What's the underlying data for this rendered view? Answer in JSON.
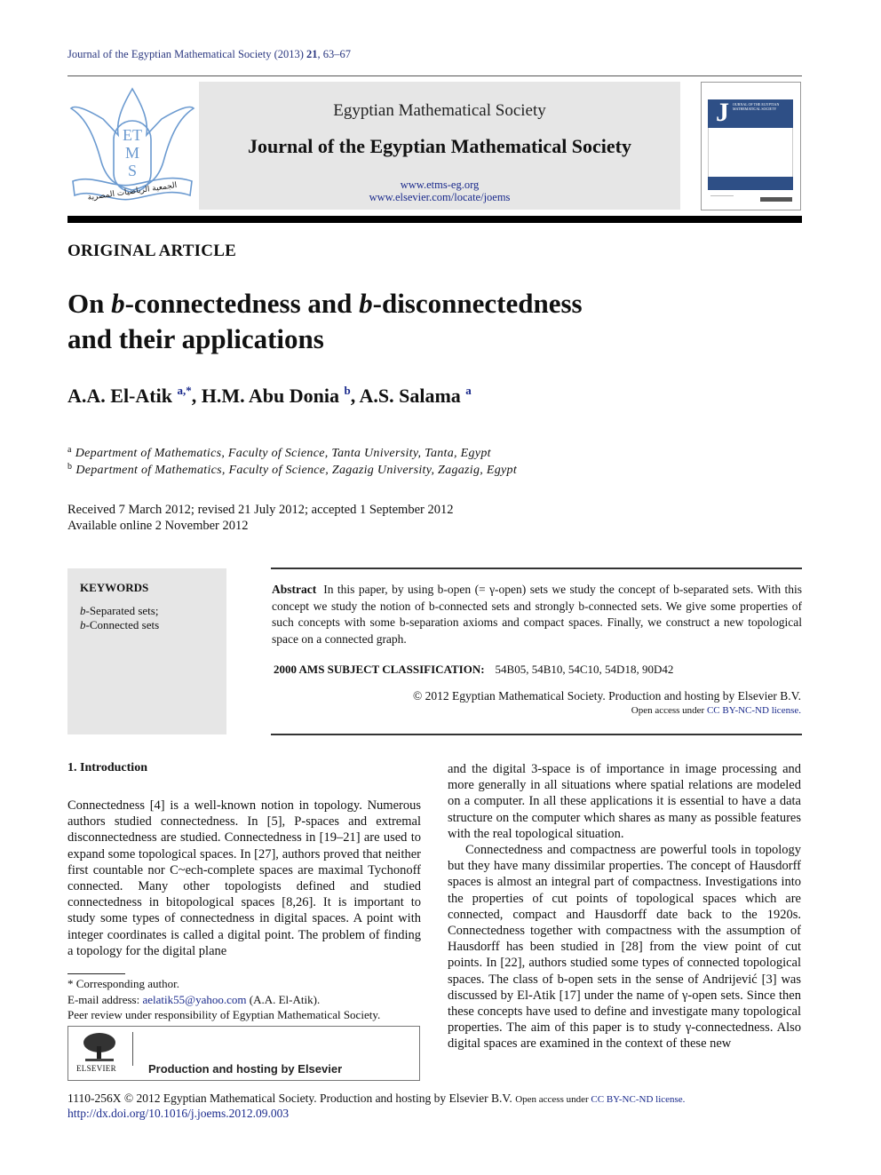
{
  "running_head": {
    "journal": "Journal of the Egyptian Mathematical Society (2013) ",
    "volume": "21",
    "pages": ", 63–67"
  },
  "masthead": {
    "logo_letters": [
      "ET",
      "M",
      "S"
    ],
    "logo_arabic": "الجمعية الرياضيات المصرية",
    "society": "Egyptian Mathematical Society",
    "journal": "Journal of the Egyptian Mathematical Society",
    "url1": "www.etms-eg.org",
    "url2": "www.elsevier.com/locate/joems",
    "cover_letter": "J",
    "cover_text": "OURNAL OF THE EGYPTIAN MATHEMATICAL SOCIETY"
  },
  "article_type": "ORIGINAL ARTICLE",
  "title": {
    "part1": "On ",
    "b1": "b",
    "part2": "-connectedness and ",
    "b2": "b",
    "part3": "-disconnectedness",
    "line2": "and their applications"
  },
  "authors": [
    {
      "name": "A.A. El-Atik ",
      "sup": "a,*",
      "sep": ", "
    },
    {
      "name": "H.M. Abu Donia ",
      "sup": "b",
      "sep": ", "
    },
    {
      "name": "A.S. Salama ",
      "sup": "a",
      "sep": ""
    }
  ],
  "affiliations": [
    {
      "mark": "a",
      "text": "Department of Mathematics, Faculty of Science, Tanta University, Tanta, Egypt"
    },
    {
      "mark": "b",
      "text": "Department of Mathematics, Faculty of Science, Zagazig University, Zagazig, Egypt"
    }
  ],
  "dates": {
    "history": "Received 7 March 2012; revised 21 July 2012; accepted 1 September 2012",
    "online": "Available online 2 November 2012"
  },
  "keywords": {
    "title": "KEYWORDS",
    "items": [
      {
        "prefix": "b",
        "text": "-Separated sets;"
      },
      {
        "prefix": "b",
        "text": "-Connected sets"
      }
    ]
  },
  "abstract": {
    "label": "Abstract",
    "text": "In this paper, by using b-open (= γ-open) sets we study the concept of b-separated sets. With this concept we study the notion of b-connected sets and strongly b-connected sets. We give some properties of such concepts with some b-separation axioms and compact spaces. Finally, we construct a new topological space on a connected graph.",
    "ams_label": "2000 AMS SUBJECT CLASSIFICATION:",
    "ams_codes": "54B05, 54B10, 54C10, 54D18, 90D42",
    "copyright": "© 2012 Egyptian Mathematical Society. Production and hosting by Elsevier B.V.",
    "open_access_prefix": "Open access under ",
    "license": "CC BY-NC-ND license."
  },
  "intro": {
    "heading": "1. Introduction",
    "left_column": "Connectedness [4] is a well-known notion in topology. Numerous authors studied connectedness. In [5], P-spaces and extremal disconnectedness are studied. Connectedness in [19–21] are used to expand some topological spaces. In [27], authors proved that neither first countable nor C~ech-complete spaces are maximal Tychonoff connected. Many other topologists defined and studied connectedness in bitopological spaces [8,26]. It is important to study some types of connectedness in digital spaces. A point with integer coordinates is called a digital point. The problem of finding a topology for the digital plane",
    "right_column_p1": "and the digital 3-space is of importance in image processing and more generally in all situations where spatial relations are modeled on a computer. In all these applications it is essential to have a data structure on the computer which shares as many as possible features with the real topological situation.",
    "right_column_p2": "Connectedness and compactness are powerful tools in topology but they have many dissimilar properties. The concept of Hausdorff spaces is almost an integral part of compactness. Investigations into the properties of cut points of topological spaces which are connected, compact and Hausdorff date back to the 1920s. Connectedness together with compactness with the assumption of Hausdorff has been studied in [28] from the view point of cut points. In [22], authors studied some types of connected topological spaces. The class of b-open sets in the sense of Andrijević [3] was discussed by El-Atik [17] under the name of γ-open sets. Since then these concepts have used to define and investigate many topological properties. The aim of this paper is to study γ-connectedness. Also digital spaces are examined in the context of these new"
  },
  "footnotes": {
    "corresponding": "* Corresponding author.",
    "email_label": "E-mail address: ",
    "email": "aelatik55@yahoo.com",
    "email_suffix": " (A.A. El-Atik).",
    "peer_review": "Peer review under responsibility of Egyptian Mathematical Society."
  },
  "elsevier_box": {
    "logo_word": "ELSEVIER",
    "text": "Production and hosting by Elsevier"
  },
  "bottom": {
    "issn_copyright": "1110-256X © 2012 Egyptian Mathematical Society. Production and hosting by Elsevier B.V. ",
    "open_access_prefix": "Open access under ",
    "license": "CC BY-NC-ND license.",
    "doi": "http://dx.doi.org/10.1016/j.joems.2012.09.003"
  }
}
